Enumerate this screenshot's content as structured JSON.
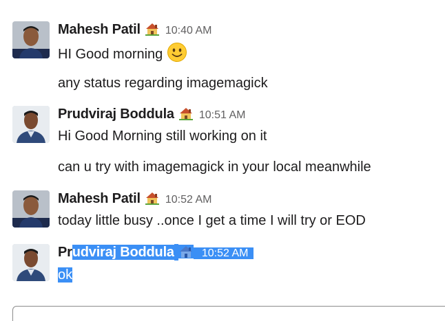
{
  "messages": [
    {
      "author": "Mahesh Patil",
      "time": "10:40 AM",
      "lines": [
        "HI Good morning",
        "any status regarding imagemagick"
      ]
    },
    {
      "author": "Prudviraj Boddula",
      "time": "10:51 AM",
      "lines": [
        "Hi Good Morning still working on it",
        "can u try with imagemagick in your local meanwhile"
      ]
    },
    {
      "author": "Mahesh Patil",
      "time": "10:52 AM",
      "lines": [
        "today little busy ..once I get a time I will try or EOD"
      ]
    },
    {
      "author_unselected": "Pr",
      "author_selected": "udviraj Boddula",
      "time": "10:52 AM",
      "lines": [
        "ok"
      ]
    }
  ],
  "icons": {
    "status": "house-emoji-icon",
    "smiley": "slightly-smiling-face-icon"
  },
  "colors": {
    "selection": "#3b8ff5",
    "timestamp": "#616061"
  }
}
